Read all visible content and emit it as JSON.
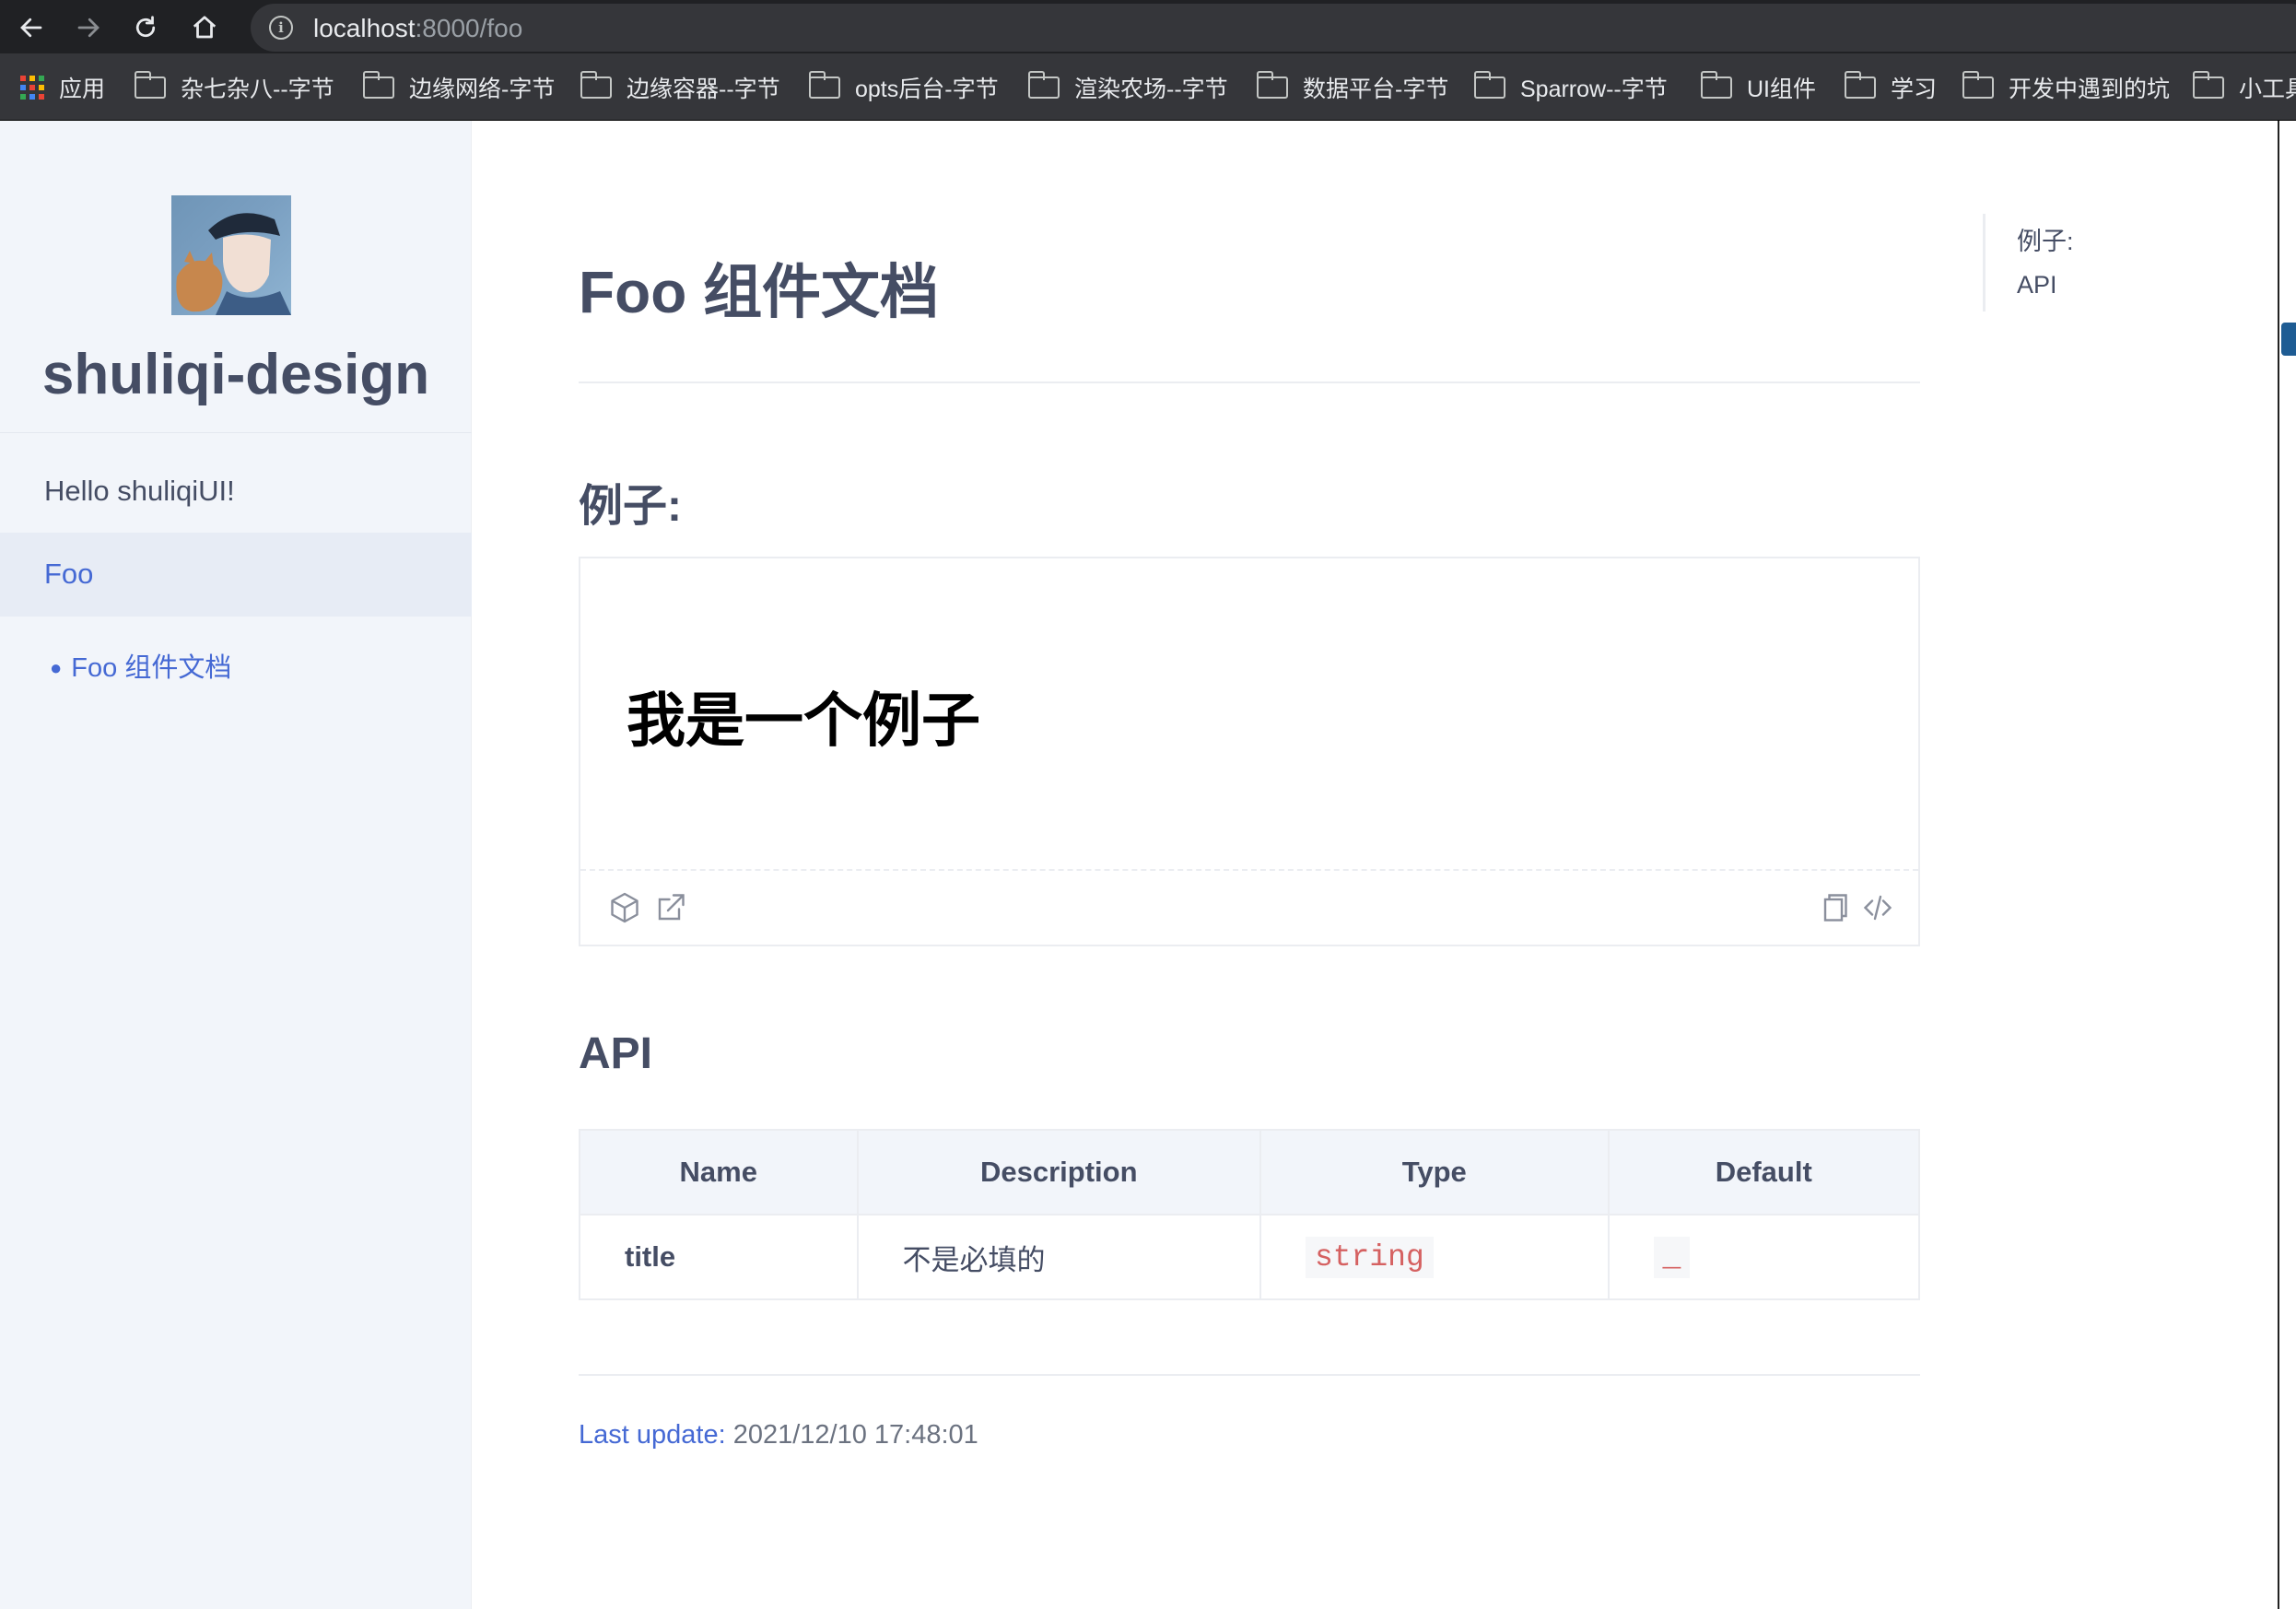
{
  "browser": {
    "url_host": "localhost",
    "url_path": ":8000/foo",
    "bookmarks": [
      {
        "label": "应用",
        "icon": "apps-grid-icon"
      },
      {
        "label": "杂七杂八--字节",
        "icon": "folder-icon"
      },
      {
        "label": "边缘网络-字节",
        "icon": "folder-icon"
      },
      {
        "label": "边缘容器--字节",
        "icon": "folder-icon"
      },
      {
        "label": "opts后台-字节",
        "icon": "folder-icon"
      },
      {
        "label": "渲染农场--字节",
        "icon": "folder-icon"
      },
      {
        "label": "数据平台-字节",
        "icon": "folder-icon"
      },
      {
        "label": "Sparrow--字节",
        "icon": "folder-icon"
      },
      {
        "label": "UI组件",
        "icon": "folder-icon"
      },
      {
        "label": "学习",
        "icon": "folder-icon"
      },
      {
        "label": "开发中遇到的坑",
        "icon": "folder-icon"
      },
      {
        "label": "小工具",
        "icon": "folder-icon"
      }
    ]
  },
  "sidebar": {
    "site_title": "shuliqi-design",
    "items": [
      {
        "label": "Hello shuliqiUI!"
      },
      {
        "label": "Foo"
      }
    ],
    "sub_items": [
      {
        "label": "Foo 组件文档"
      }
    ]
  },
  "main": {
    "title": "Foo 组件文档",
    "example_heading": "例子:",
    "demo_text": "我是一个例子",
    "api_heading": "API",
    "table": {
      "headers": [
        "Name",
        "Description",
        "Type",
        "Default"
      ],
      "rows": [
        {
          "name": "title",
          "description": "不是必填的",
          "type": "string",
          "default": "_"
        }
      ]
    },
    "last_update_label": "Last update:",
    "last_update_value": "2021/12/10 17:48:01"
  },
  "toc": {
    "items": [
      "例子:",
      "API"
    ]
  },
  "colors": {
    "accent": "#4569d4",
    "text": "#454d64",
    "sidebar_bg": "#f2f5fa",
    "code_red": "#d56161"
  }
}
